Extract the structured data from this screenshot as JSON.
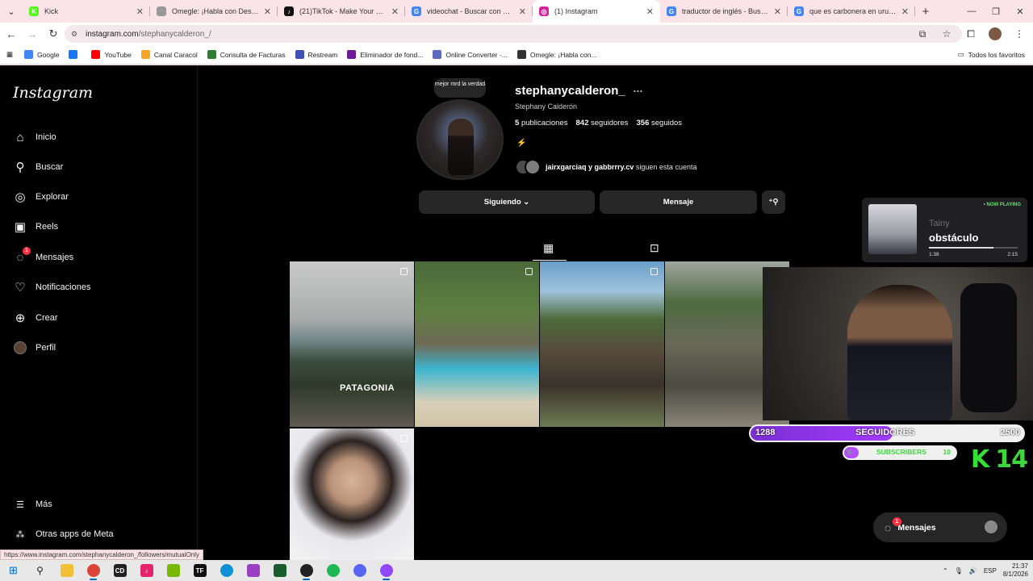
{
  "browser": {
    "tabs": [
      {
        "title": "Kick",
        "color": "#53fc18",
        "glyph": "K"
      },
      {
        "title": "Omegle: ¡Habla con Desconocid",
        "color": "#999999",
        "glyph": ""
      },
      {
        "title": "(21)TikTok - Make Your Day",
        "color": "#111111",
        "glyph": "♪"
      },
      {
        "title": "videochat - Buscar con Google",
        "color": "#4285f4",
        "glyph": "G"
      },
      {
        "title": "(1) Instagram",
        "color": "#d6249f",
        "glyph": "◎",
        "active": true
      },
      {
        "title": "traductor de inglés - Buscar co",
        "color": "#4285f4",
        "glyph": "G"
      },
      {
        "title": "que es carbonera en uruguay -",
        "color": "#4285f4",
        "glyph": "G"
      }
    ],
    "address": {
      "host": "instagram.com",
      "path": "/stephanycalderon_/"
    },
    "bookmarks": [
      {
        "label": "Google",
        "color": "#4285f4"
      },
      {
        "label": "",
        "color": "#1877f2"
      },
      {
        "label": "YouTube",
        "color": "#ff0000"
      },
      {
        "label": "Canal Caracol",
        "color": "#f5a623"
      },
      {
        "label": "Consulta de Facturas",
        "color": "#2e7d32"
      },
      {
        "label": "Restream",
        "color": "#3f51b5"
      },
      {
        "label": "Eliminador de fond...",
        "color": "#6a1b9a"
      },
      {
        "label": "Online Converter -...",
        "color": "#5c6bc0"
      },
      {
        "label": "Omegle: ¡Habla con...",
        "color": "#333333"
      }
    ],
    "all_bookmarks": "Todos los favoritos",
    "status_url": "https://www.instagram.com/stephanycalderon_/followers/mutualOnly"
  },
  "instagram": {
    "logo": "Instagram",
    "nav": [
      {
        "label": "Inicio",
        "icon": "home-icon",
        "glyph": "⌂"
      },
      {
        "label": "Buscar",
        "icon": "search-icon",
        "glyph": "⚲"
      },
      {
        "label": "Explorar",
        "icon": "compass-icon",
        "glyph": "◎"
      },
      {
        "label": "Reels",
        "icon": "reels-icon",
        "glyph": "▣"
      },
      {
        "label": "Mensajes",
        "icon": "messenger-icon",
        "glyph": "◌",
        "badge": "1"
      },
      {
        "label": "Notificaciones",
        "icon": "heart-icon",
        "glyph": "♡"
      },
      {
        "label": "Crear",
        "icon": "plus-icon",
        "glyph": "⊕"
      },
      {
        "label": "Perfil",
        "icon": "profile-icon",
        "glyph": ""
      }
    ],
    "more": "Más",
    "meta_apps": "Otras apps de Meta",
    "profile": {
      "note": "mejor mrd la verdad",
      "username": "stephanycalderon_",
      "full_name": "Stephany Calderón",
      "posts_count": "5",
      "posts_label": "publicaciones",
      "followers_count": "842",
      "followers_label": "seguidores",
      "following_count": "356",
      "following_label": "seguidos",
      "bio_emoji": "⚡",
      "mutual_names": "jairxgarciaq y gabbrrry.cv",
      "mutual_suffix": "siguen esta cuenta",
      "following_button": "Siguiendo",
      "message_button": "Mensaje"
    },
    "posts": [
      {
        "label": "PATAGONIA"
      },
      {
        "label": ""
      },
      {
        "label": ""
      },
      {
        "label": ""
      },
      {
        "label": ""
      }
    ],
    "messages_bar": {
      "label": "Mensajes",
      "badge": "1"
    }
  },
  "overlays": {
    "now_playing": {
      "tag": "• NOW PLAYING",
      "artist": "Tainy",
      "song": "obstáculo",
      "elapsed": "1:38",
      "duration": "2:15",
      "progress": 0.73
    },
    "follower_goal": {
      "current": "1288",
      "label": "SEGUIDORES",
      "target": "2500",
      "progress": 0.52
    },
    "subscriber_goal": {
      "current": "0",
      "label": "SUBSCRIBERS",
      "target": "10"
    },
    "kick_brand": "K",
    "kick_number": "14"
  },
  "taskbar": {
    "lang": "ESP",
    "time": "21:37",
    "date": "8/1/2026"
  }
}
